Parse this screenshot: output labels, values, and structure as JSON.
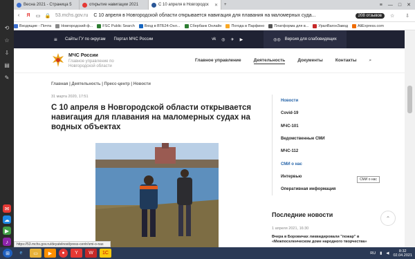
{
  "browser": {
    "tabs": [
      {
        "title": "Весна 2021 - Страница 5",
        "color": "#3b6fd0"
      },
      {
        "title": "открытие навигации 2021",
        "color": "#e53935"
      },
      {
        "title": "С 10 апреля в Новгородск",
        "color": "#2b5797",
        "active": true
      }
    ],
    "url": "53.mchs.gov.ru",
    "page_title": "С 10 апреля в Новгородской области открывается навигация для плавания на маломерных суда...",
    "reviews": "208 отзывов",
    "bookmarks": [
      {
        "label": "Входящие - Почта",
        "color": "#3b6fd0"
      },
      {
        "label": "Новгородский ф...",
        "color": "#888"
      },
      {
        "label": "FSC Public Search",
        "color": "#2e7d32"
      },
      {
        "label": "Вход в ВТБ24-Онл...",
        "color": "#1565c0"
      },
      {
        "label": "Сбербанк Онлайн",
        "color": "#2e7d32"
      },
      {
        "label": "Погода в Парфино",
        "color": "#f9a825"
      },
      {
        "label": "Платформа для в...",
        "color": "#555"
      },
      {
        "label": "УралВагонЗавод",
        "color": "#c62828"
      },
      {
        "label": "AliExpress.com",
        "color": "#ef6c00"
      }
    ],
    "status_url": "https://53.mchs.gov.ru/deyatelnost/press-centr/smi-o-nas"
  },
  "site": {
    "top_links": [
      "Сайты ГУ по округам",
      "Портал МЧС России"
    ],
    "social_icons": [
      "vk-icon",
      "ok-icon",
      "telegram-icon",
      "youtube-icon"
    ],
    "social_glyphs": [
      "vk",
      "◎",
      "✈",
      "▶"
    ],
    "vision_label": "Версия для слабовидящих",
    "brand": "МЧС России",
    "brand_sub": "Главное управление по Новгородской области",
    "nav": [
      "Главное управление",
      "Деятельность",
      "Документы",
      "Контакты"
    ],
    "nav_active_index": 1
  },
  "article": {
    "breadcrumbs": "Главная  |  Деятельность  |  Пресс-центр  |  Новости",
    "date": "31 марта 2020, 17:51",
    "title": "С 10 апреля в Новгородской области открывается навигация для плавания на маломерных судах на водных объектах"
  },
  "sidemenu": {
    "items": [
      "Новости",
      "Covid-19",
      "МЧС-101",
      "Ведомственные СМИ",
      "МЧС-112",
      "СМИ о нас",
      "Интервью",
      "Оперативная информация"
    ],
    "active_index": 0,
    "hover_index": 5,
    "tooltip": "СМИ о нас"
  },
  "latest": {
    "heading": "Последние новости",
    "date": "1 апреля 2021, 16:30",
    "text": "Вчера в Боровичах ликвидировали \"пожар\" в «Межпоселенческом доме народного творчества»"
  },
  "taskbar": {
    "lang": "RU",
    "time": "8:32",
    "date": "02.04.2021"
  }
}
